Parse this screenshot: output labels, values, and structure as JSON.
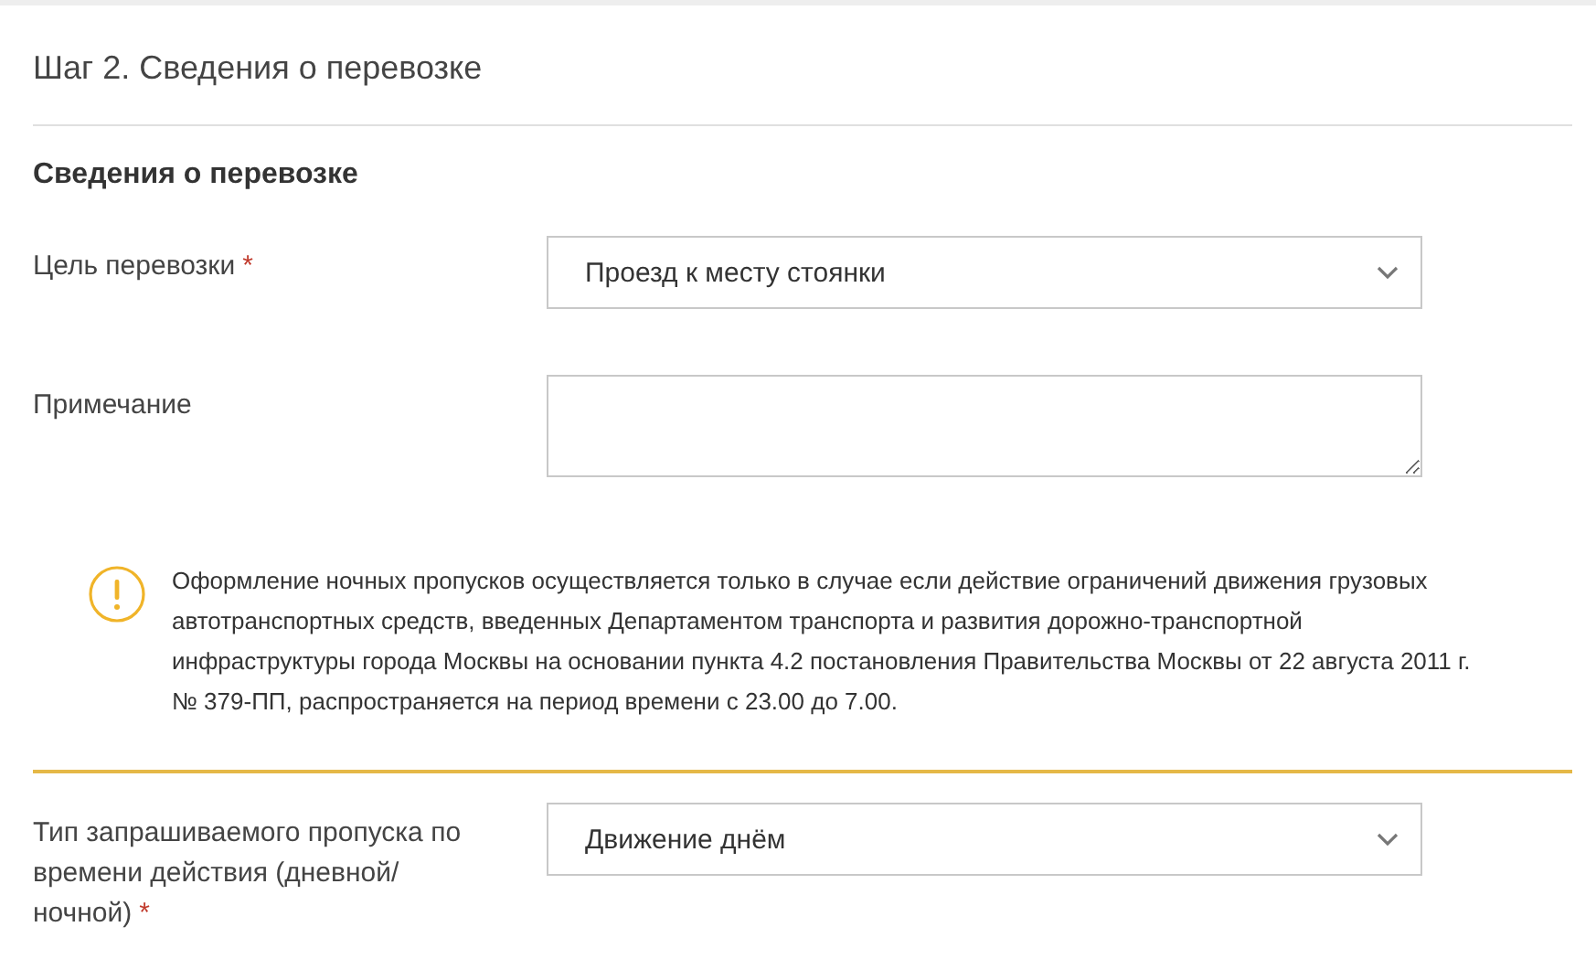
{
  "step_title": "Шаг 2. Сведения о перевозке",
  "section_title": "Сведения о перевозке",
  "fields": [
    {
      "kind": "select",
      "label": "Цель перевозки",
      "required_mark": "*",
      "value": "Проезд к месту стоянки"
    },
    {
      "kind": "textarea",
      "label": "Примечание"
    },
    {
      "kind": "notice",
      "text": "Оформление ночных пропусков осуществляется только в случае если действие ограничений движения грузовых автотранспортных средств, введенных Департаментом транспорта и развития дорожно-транспортной инфраструктуры города Москвы на основании пункта 4.2 постановления Правительства Москвы от 22 августа 2011 г. № 379-ПП, распространяется на период времени с 23.00 до 7.00."
    },
    {
      "kind": "select",
      "label": "Тип запрашиваемого пропуска по времени действия (дневной/ ночной)",
      "required_mark": "*",
      "value": "Движение днём"
    }
  ]
}
